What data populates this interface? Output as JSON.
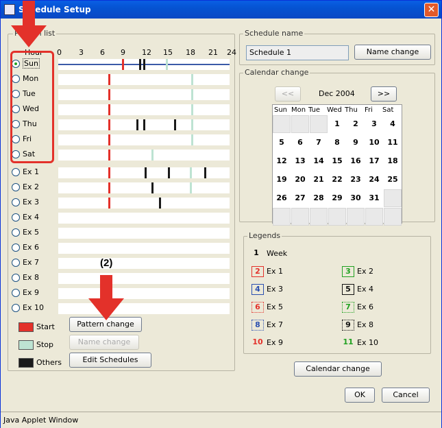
{
  "window": {
    "title": "Schedule Setup",
    "status_text": "Java Applet Window"
  },
  "colors": {
    "start": "#e3312a",
    "stop": "#bde3d2",
    "others": "#1a1a1a",
    "sun_line": "#3a5aa8",
    "highlight": "#e3312a"
  },
  "pattern_list": {
    "legend": "Pattern list",
    "hour_label": "Hour",
    "hours": [
      "0",
      "3",
      "6",
      "9",
      "12",
      "15",
      "18",
      "21",
      "24"
    ],
    "rows": [
      {
        "label": "Sun",
        "checked": true,
        "marks": [
          {
            "hour": 8.9,
            "kind": "start"
          },
          {
            "hour": 11.3,
            "kind": "others"
          },
          {
            "hour": 11.9,
            "kind": "others"
          },
          {
            "hour": 15.1,
            "kind": "stop"
          }
        ]
      },
      {
        "label": "Mon",
        "checked": false,
        "marks": [
          {
            "hour": 7.0,
            "kind": "start"
          },
          {
            "hour": 18.6,
            "kind": "stop"
          }
        ]
      },
      {
        "label": "Tue",
        "checked": false,
        "marks": [
          {
            "hour": 7.0,
            "kind": "start"
          },
          {
            "hour": 18.6,
            "kind": "stop"
          }
        ]
      },
      {
        "label": "Wed",
        "checked": false,
        "marks": [
          {
            "hour": 7.0,
            "kind": "start"
          },
          {
            "hour": 18.6,
            "kind": "stop"
          }
        ]
      },
      {
        "label": "Thu",
        "checked": false,
        "marks": [
          {
            "hour": 7.0,
            "kind": "start"
          },
          {
            "hour": 10.9,
            "kind": "others"
          },
          {
            "hour": 11.9,
            "kind": "others"
          },
          {
            "hour": 16.2,
            "kind": "others"
          },
          {
            "hour": 18.6,
            "kind": "stop"
          }
        ]
      },
      {
        "label": "Fri",
        "checked": false,
        "marks": [
          {
            "hour": 7.0,
            "kind": "start"
          },
          {
            "hour": 18.6,
            "kind": "stop"
          }
        ]
      },
      {
        "label": "Sat",
        "checked": false,
        "marks": [
          {
            "hour": 7.0,
            "kind": "start"
          },
          {
            "hour": 13.1,
            "kind": "stop"
          }
        ]
      },
      {
        "label": "Ex 1",
        "checked": false,
        "marks": [
          {
            "hour": 7.0,
            "kind": "start"
          },
          {
            "hour": 12.1,
            "kind": "others"
          },
          {
            "hour": 15.4,
            "kind": "others"
          },
          {
            "hour": 18.4,
            "kind": "stop"
          },
          {
            "hour": 20.4,
            "kind": "others"
          }
        ]
      },
      {
        "label": "Ex 2",
        "checked": false,
        "marks": [
          {
            "hour": 7.0,
            "kind": "start"
          },
          {
            "hour": 13.1,
            "kind": "others"
          },
          {
            "hour": 18.4,
            "kind": "stop"
          }
        ]
      },
      {
        "label": "Ex 3",
        "checked": false,
        "marks": [
          {
            "hour": 7.0,
            "kind": "start"
          },
          {
            "hour": 14.1,
            "kind": "others"
          }
        ]
      },
      {
        "label": "Ex 4",
        "checked": false,
        "marks": []
      },
      {
        "label": "Ex 5",
        "checked": false,
        "marks": []
      },
      {
        "label": "Ex 6",
        "checked": false,
        "marks": []
      },
      {
        "label": "Ex 7",
        "checked": false,
        "marks": []
      },
      {
        "label": "Ex 8",
        "checked": false,
        "marks": []
      },
      {
        "label": "Ex 9",
        "checked": false,
        "marks": []
      },
      {
        "label": "Ex 10",
        "checked": false,
        "marks": []
      }
    ],
    "legend_items": {
      "start": "Start",
      "stop": "Stop",
      "others": "Others"
    },
    "buttons": {
      "pattern_change": "Pattern change",
      "name_change": "Name change",
      "edit_schedules": "Edit Schedules"
    }
  },
  "schedule_name": {
    "legend": "Schedule name",
    "value": "Schedule 1",
    "button": "Name change"
  },
  "calendar": {
    "legend": "Calendar change",
    "prev": "<<",
    "next": ">>",
    "month": "Dec 2004",
    "days_of_week": [
      "Sun",
      "Mon",
      "Tue",
      "Wed",
      "Thu",
      "Fri",
      "Sat"
    ],
    "weeks": [
      [
        "",
        "",
        "",
        "1",
        "2",
        "3",
        "4"
      ],
      [
        "5",
        "6",
        "7",
        "8",
        "9",
        "10",
        "11"
      ],
      [
        "12",
        "13",
        "14",
        "15",
        "16",
        "17",
        "18"
      ],
      [
        "19",
        "20",
        "21",
        "22",
        "23",
        "24",
        "25"
      ],
      [
        "26",
        "27",
        "28",
        "29",
        "30",
        "31",
        ""
      ],
      [
        "",
        "",
        "",
        "",
        "",
        "",
        ""
      ]
    ],
    "button": "Calendar change"
  },
  "legends": {
    "legend": "Legends",
    "week": {
      "num": "1",
      "label": "Week"
    },
    "items": [
      {
        "num": "2",
        "label": "Ex 1",
        "color": "#e3312a",
        "style": "solid"
      },
      {
        "num": "3",
        "label": "Ex 2",
        "color": "#21a121",
        "style": "solid"
      },
      {
        "num": "4",
        "label": "Ex 3",
        "color": "#2a4fb0",
        "style": "solid"
      },
      {
        "num": "5",
        "label": "Ex 4",
        "color": "#111111",
        "style": "solid"
      },
      {
        "num": "6",
        "label": "Ex 5",
        "color": "#e3312a",
        "style": "dotted"
      },
      {
        "num": "7",
        "label": "Ex 6",
        "color": "#21a121",
        "style": "dotted"
      },
      {
        "num": "8",
        "label": "Ex 7",
        "color": "#2a4fb0",
        "style": "dotted"
      },
      {
        "num": "9",
        "label": "Ex 8",
        "color": "#111111",
        "style": "dotted"
      },
      {
        "num": "10",
        "label": "Ex 9",
        "color": "#e3312a",
        "style": "none"
      },
      {
        "num": "11",
        "label": "Ex 10",
        "color": "#21a121",
        "style": "none"
      }
    ]
  },
  "dialog_buttons": {
    "ok": "OK",
    "cancel": "Cancel"
  },
  "annotation": {
    "step_label": "(2)"
  }
}
